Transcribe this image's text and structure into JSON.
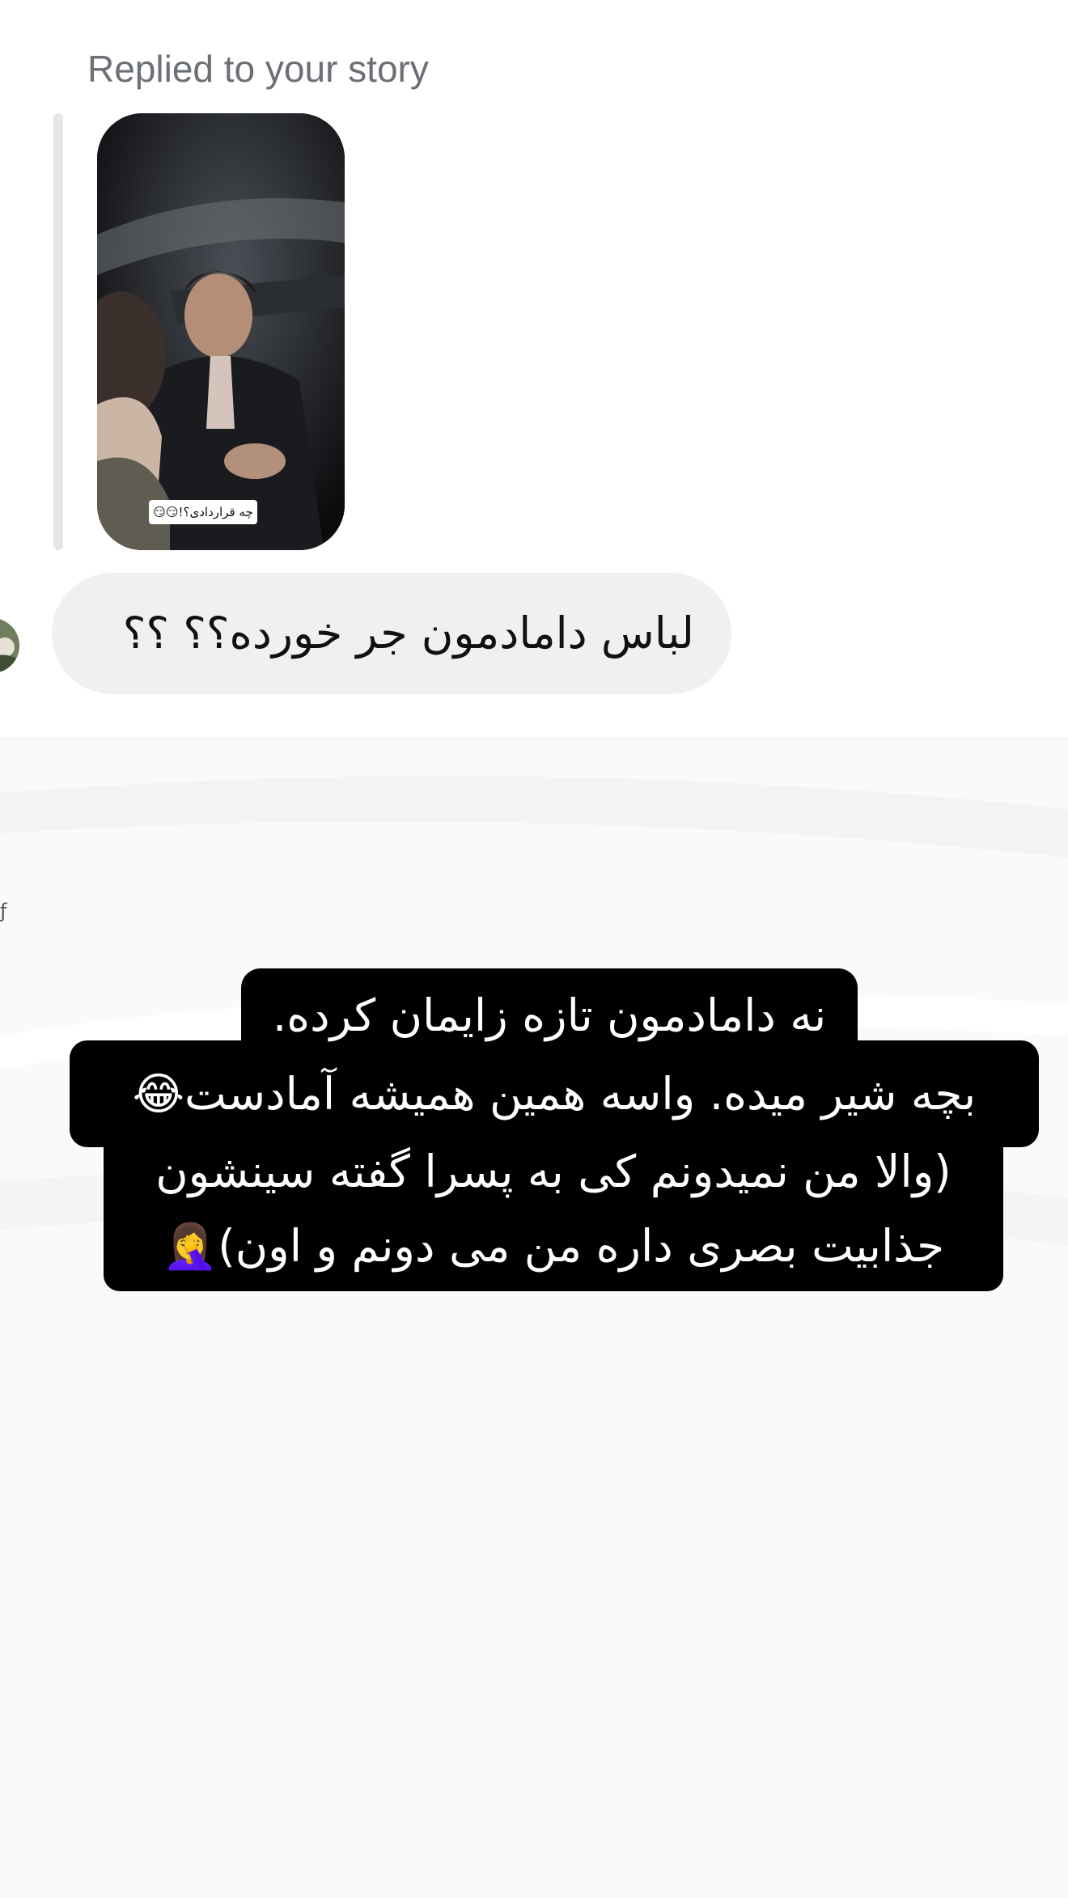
{
  "reply_header": {
    "label": "Replied to your story"
  },
  "story_preview": {
    "sticker_text": "چه قراردادی؟!😏😏"
  },
  "message": {
    "text": "لباس دامادمون جر خورده؟؟ ؟؟"
  },
  "story_caption": {
    "lines": [
      "نه دامادمون تازه زایمان کرده.",
      "بچه شیر میده. واسه همین همیشه آمادست😂",
      "(والا من نمیدونم کی به پسرا گفته سینشون",
      "جذابیت بصری داره من می دونم و اون)🤦‍♀️"
    ]
  },
  "colors": {
    "caption_background": "#000000",
    "caption_text": "#ffffff",
    "bubble_background": "#eff0f2",
    "label_text": "#6b6f76"
  }
}
